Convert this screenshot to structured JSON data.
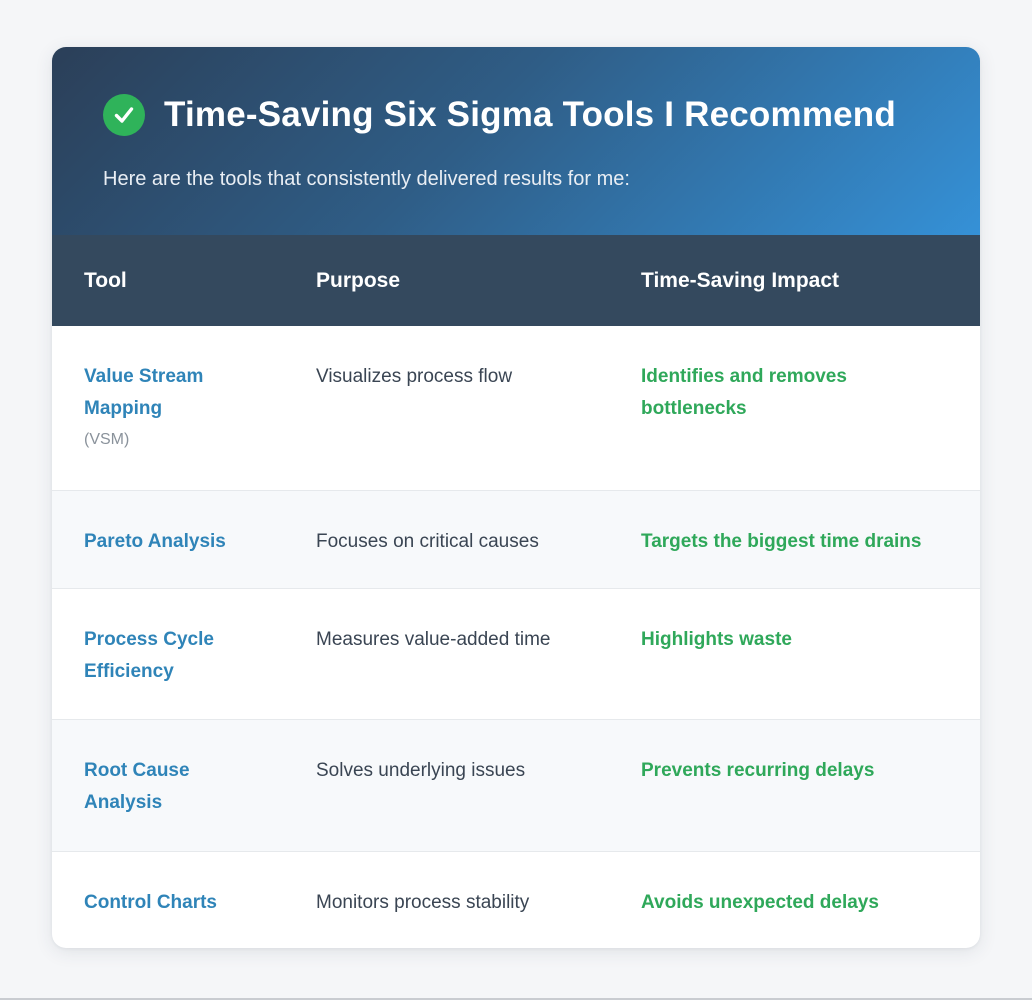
{
  "header": {
    "check_icon": "check-circle-icon",
    "title": "Time-Saving Six Sigma Tools I Recommend",
    "subtitle": "Here are the tools that consistently delivered results for me:"
  },
  "table": {
    "columns": [
      "Tool",
      "Purpose",
      "Time-Saving Impact"
    ],
    "rows": [
      {
        "tool": "Value Stream Mapping",
        "abbr": "(VSM)",
        "purpose": "Visualizes process flow",
        "impact": "Identifies and removes bottlenecks"
      },
      {
        "tool": "Pareto Analysis",
        "purpose": "Focuses on critical causes",
        "impact": "Targets the biggest time drains"
      },
      {
        "tool": "Process Cycle Efficiency",
        "purpose": "Measures value-added time",
        "impact": "Highlights waste"
      },
      {
        "tool": "Root Cause Analysis",
        "purpose": "Solves underlying issues",
        "impact": "Prevents recurring delays"
      },
      {
        "tool": "Control Charts",
        "purpose": "Monitors process stability",
        "impact": "Avoids unexpected delays"
      }
    ]
  },
  "colors": {
    "header_gradient_start": "#2b3f58",
    "header_gradient_end": "#3591d7",
    "table_header_bg": "#34495e",
    "tool_text": "#2f84b8",
    "impact_text": "#2fa85a",
    "check_bg": "#2fb35a"
  }
}
